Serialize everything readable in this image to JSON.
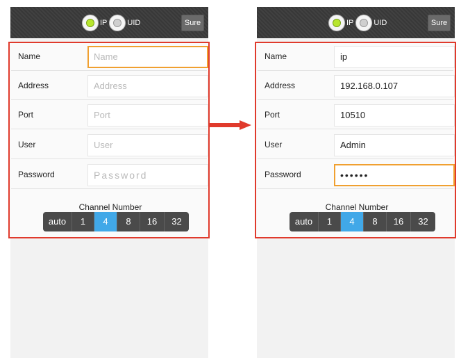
{
  "left": {
    "mode_options": [
      {
        "label": "IP",
        "selected": true
      },
      {
        "label": "UID",
        "selected": false
      }
    ],
    "sure_label": "Sure",
    "fields": [
      {
        "label": "Name",
        "placeholder": "Name",
        "value": "",
        "focused": true
      },
      {
        "label": "Address",
        "placeholder": "Address",
        "value": "",
        "focused": false
      },
      {
        "label": "Port",
        "placeholder": "Port",
        "value": "",
        "focused": false
      },
      {
        "label": "User",
        "placeholder": "User",
        "value": "",
        "focused": false
      },
      {
        "label": "Password",
        "placeholder": "Password",
        "value": "",
        "focused": false
      }
    ],
    "channel_title": "Channel Number",
    "channel_options": [
      "auto",
      "1",
      "4",
      "8",
      "16",
      "32"
    ],
    "channel_selected": "4"
  },
  "right": {
    "mode_options": [
      {
        "label": "IP",
        "selected": true
      },
      {
        "label": "UID",
        "selected": false
      }
    ],
    "sure_label": "Sure",
    "fields": [
      {
        "label": "Name",
        "placeholder": "Name",
        "value": "ip",
        "focused": false
      },
      {
        "label": "Address",
        "placeholder": "Address",
        "value": "192.168.0.107",
        "focused": false
      },
      {
        "label": "Port",
        "placeholder": "Port",
        "value": "10510",
        "focused": false
      },
      {
        "label": "User",
        "placeholder": "User",
        "value": "Admin",
        "focused": false
      },
      {
        "label": "Password",
        "placeholder": "Password",
        "value": "••••••",
        "focused": true
      }
    ],
    "channel_title": "Channel Number",
    "channel_options": [
      "auto",
      "1",
      "4",
      "8",
      "16",
      "32"
    ],
    "channel_selected": "4"
  },
  "colors": {
    "highlight_border": "#e03a2c",
    "arrow": "#e03a2c",
    "focus_border": "#f0a030",
    "channel_active": "#41a8e8",
    "radio_selected": "#b8e62e"
  }
}
